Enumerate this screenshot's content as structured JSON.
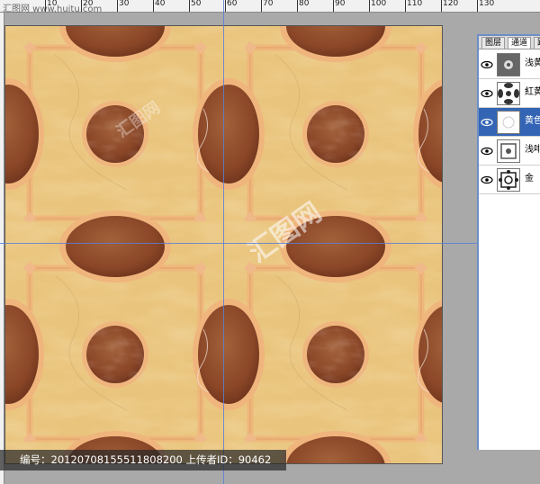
{
  "ruler": {
    "labels": [
      "10",
      "20",
      "30",
      "40",
      "50",
      "60",
      "70",
      "80",
      "90",
      "100",
      "110",
      "120",
      "130"
    ],
    "watermark": "汇图网 www.huitu.com"
  },
  "canvas_watermarks": [
    "汇图网",
    "汇图网"
  ],
  "layers_panel": {
    "tabs": [
      "图层",
      "通道",
      "路"
    ],
    "layers": [
      {
        "name": "浅黄"
      },
      {
        "name": "紅黄"
      },
      {
        "name": "黄色"
      },
      {
        "name": "浅啡"
      },
      {
        "name": "金"
      }
    ]
  },
  "caption": "编号：20120708155511808200 上传者ID：90462",
  "colors": {
    "tile_base": "#e9c47c",
    "border_band": "#efb87a",
    "medallion": "#8f4a2a",
    "selection": "#3465b5",
    "guide": "#5b7fd6"
  }
}
